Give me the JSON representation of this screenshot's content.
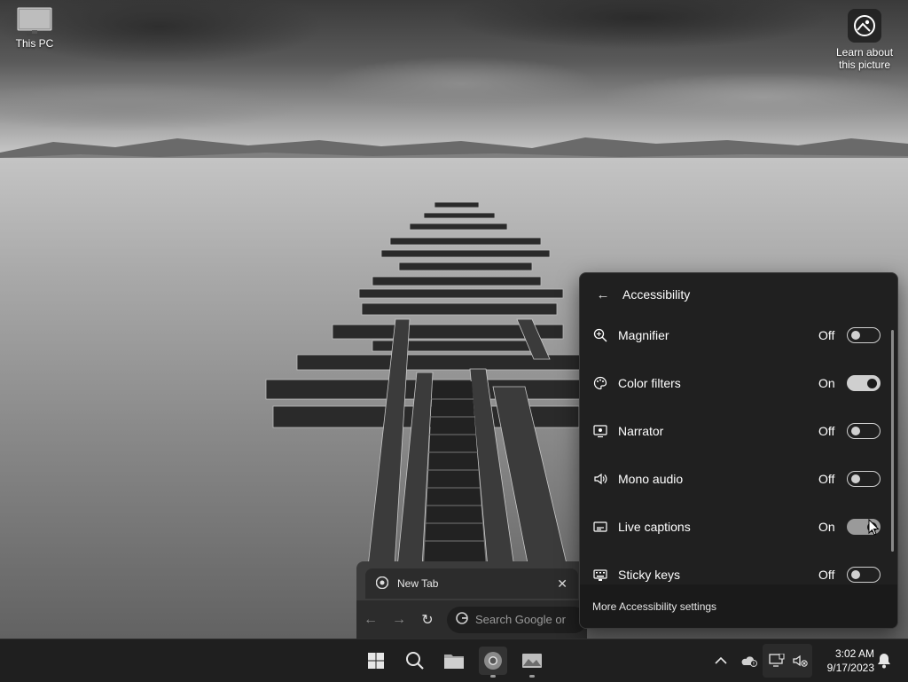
{
  "desktop": {
    "icons": [
      {
        "label": "This PC"
      },
      {
        "label_line1": "Learn about",
        "label_line2": "this picture"
      }
    ]
  },
  "browser": {
    "tab_title": "New Tab",
    "close_glyph": "✕",
    "omnibox_placeholder": "Search Google or",
    "nav": {
      "back": "←",
      "forward": "→",
      "reload": "↻"
    }
  },
  "flyout": {
    "title": "Accessibility",
    "back_glyph": "←",
    "items": [
      {
        "label": "Magnifier",
        "state": "Off",
        "on": false,
        "icon": "magnifier-icon"
      },
      {
        "label": "Color filters",
        "state": "On",
        "on": true,
        "icon": "color-palette-icon"
      },
      {
        "label": "Narrator",
        "state": "Off",
        "on": false,
        "icon": "narrator-icon"
      },
      {
        "label": "Mono audio",
        "state": "Off",
        "on": false,
        "icon": "speaker-icon"
      },
      {
        "label": "Live captions",
        "state": "On",
        "on": true,
        "icon": "captions-icon"
      },
      {
        "label": "Sticky keys",
        "state": "Off",
        "on": false,
        "icon": "keyboard-icon"
      }
    ],
    "footer_link": "More Accessibility settings"
  },
  "taskbar": {
    "apps": [
      "start-icon",
      "search-icon",
      "file-explorer-icon",
      "chrome-icon",
      "photos-icon"
    ],
    "tray": [
      "chevron-up-icon",
      "onedrive-icon",
      "network-icon",
      "volume-muted-icon"
    ],
    "time": "3:02 AM",
    "date": "9/17/2023",
    "notification_icon": "bell-icon"
  }
}
